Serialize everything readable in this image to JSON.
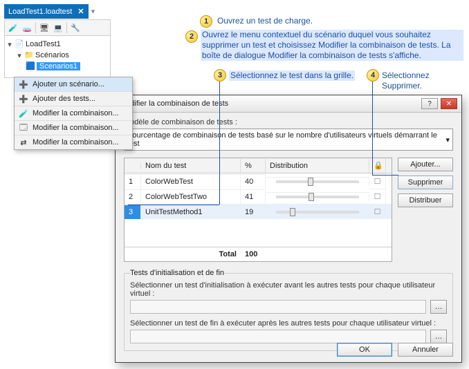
{
  "tab": {
    "label": "LoadTest1.loadtest"
  },
  "tree": {
    "root": "LoadTest1",
    "folder": "Scénarios",
    "selected_node": "Scenarios1"
  },
  "context_menu": {
    "items": [
      {
        "label": "Ajouter un scénario..."
      },
      {
        "label": "Ajouter des tests..."
      },
      {
        "label": "Modifier la combinaison..."
      },
      {
        "label": "Modifier la combinaison..."
      },
      {
        "label": "Modifier la combinaison..."
      }
    ]
  },
  "steps": {
    "s1": "Ouvrez un test de charge.",
    "s2": "Ouvrez le menu contextuel du scénario duquel vous souhaitez supprimer un test et choisissez Modifier la combinaison de tests. La boîte de dialogue Modifier la combinaison de tests s'affiche.",
    "s3": "Sélectionnez le test dans la grille.",
    "s4": "Sélectionnez Supprimer."
  },
  "dialog": {
    "title": "Modifier la combinaison de tests",
    "model_label": "Modèle de combinaison de tests :",
    "model_dropdown": "Pourcentage de combinaison de tests basé sur le nombre d'utilisateurs virtuels démarrant le test",
    "grid": {
      "headers": {
        "name": "Nom du test",
        "percent": "%",
        "dist": "Distribution"
      },
      "rows": [
        {
          "idx": "1",
          "name": "ColorWebTest",
          "percent": "40",
          "slider": 40
        },
        {
          "idx": "2",
          "name": "ColorWebTestTwo",
          "percent": "41",
          "slider": 41
        },
        {
          "idx": "3",
          "name": "UnitTestMethod1",
          "percent": "19",
          "slider": 19
        }
      ],
      "total_label": "Total",
      "total_value": "100"
    },
    "buttons": {
      "add": "Ajouter...",
      "remove": "Supprimer",
      "distribute": "Distribuer",
      "ok": "OK",
      "cancel": "Annuler"
    },
    "init_group": {
      "legend": "Tests d'initialisation et de fin",
      "init_label": "Sélectionner un test d'initialisation à exécuter avant les autres tests pour chaque utilisateur virtuel :",
      "end_label": "Sélectionner un test de fin à exécuter après les autres tests pour chaque utilisateur virtuel :"
    }
  }
}
